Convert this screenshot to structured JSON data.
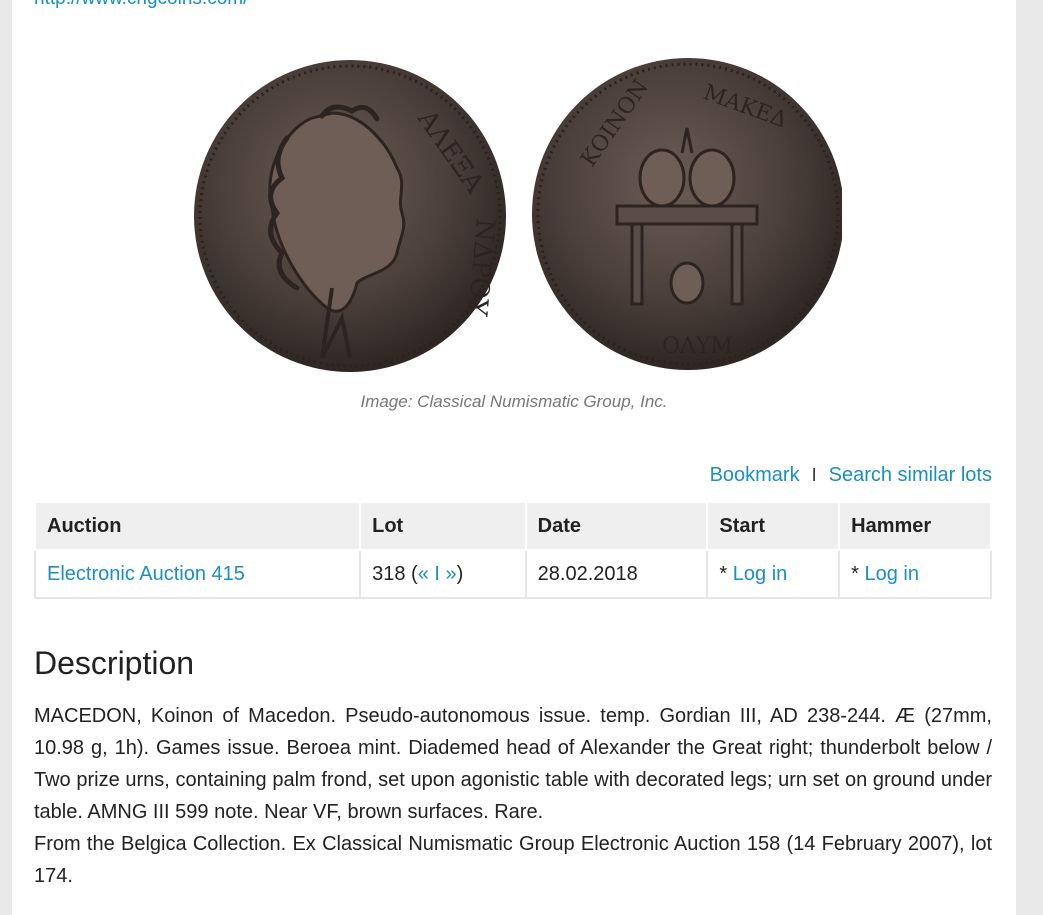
{
  "top_link": "http://www.cngcoins.com/",
  "image_credit": "Image: Classical Numismatic Group, Inc.",
  "actions": {
    "bookmark": "Bookmark",
    "separator": "I",
    "search_similar": "Search similar lots"
  },
  "table": {
    "headers": {
      "auction": "Auction",
      "lot": "Lot",
      "date": "Date",
      "start": "Start",
      "hammer": "Hammer"
    },
    "row": {
      "auction": "Electronic Auction 415",
      "lot_number": "318 (",
      "prev": "«",
      "lot_sep": " I ",
      "next": "»",
      "lot_close": ")",
      "date": "28.02.2018",
      "start_prefix": "* ",
      "start_login": "Log in",
      "hammer_prefix": "* ",
      "hammer_login": "Log in"
    }
  },
  "description": {
    "title": "Description",
    "paragraph1": "MACEDON, Koinon of Macedon. Pseudo-autonomous issue. temp. Gordian III, AD 238-244. Æ (27mm, 10.98 g, 1h). Games issue. Beroea mint. Diademed head of Alexander the Great right; thunderbolt below / Two prize urns, containing palm frond, set upon agonistic table with decorated legs; urn set on ground under table. AMNG III 599 note. Near VF, brown surfaces. Rare.",
    "paragraph2": "From the Belgica Collection. Ex Classical Numismatic Group Electronic Auction 158 (14 February 2007), lot 174."
  },
  "colors": {
    "link": "#1a8fc4",
    "header_bg": "#efefef",
    "coin_dark": "#3e3430",
    "coin_mid": "#5e514b"
  }
}
